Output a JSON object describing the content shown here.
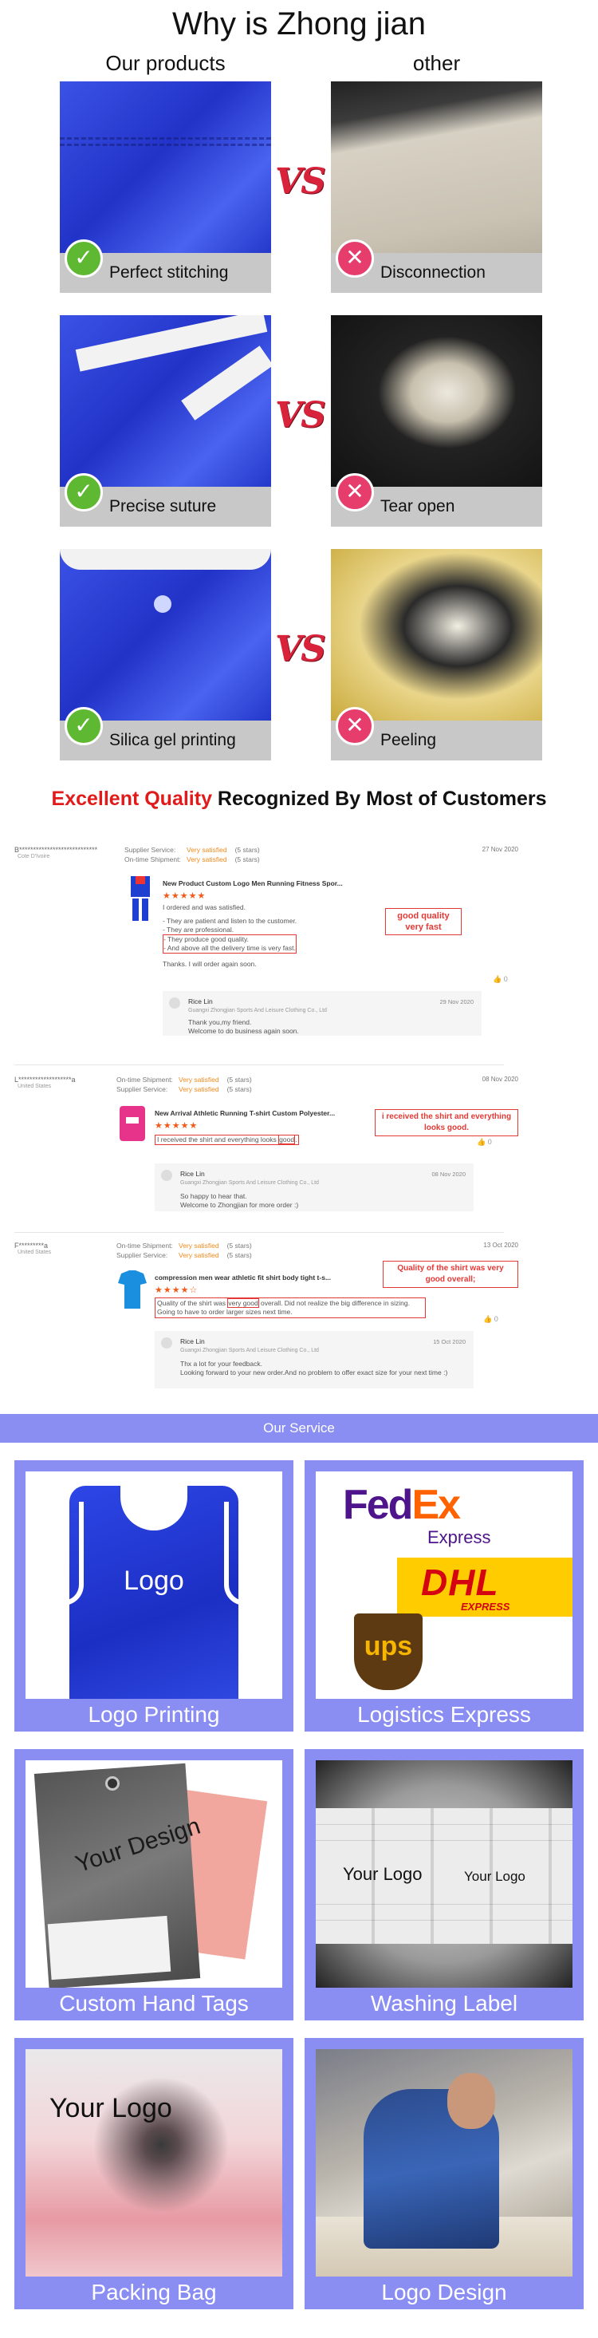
{
  "comparison": {
    "title": "Why is Zhong jian",
    "left_heading": "Our products",
    "right_heading": "other",
    "vs": "VS",
    "rows": [
      {
        "ours_label": "Perfect stitching",
        "theirs_label": "Disconnection"
      },
      {
        "ours_label": "Precise suture",
        "theirs_label": "Tear open"
      },
      {
        "ours_label": "Silica gel printing",
        "theirs_label": "Peeling"
      }
    ]
  },
  "quality_heading": {
    "red": "Excellent Quality",
    "rest": " Recognized By Most of Customers"
  },
  "reviews": [
    {
      "user": "B****************************",
      "country": "Cote D'Ivoire",
      "date": "27 Nov 2020",
      "meta": [
        {
          "key": "Supplier Service:",
          "value": "Very satisfied",
          "score": "(5 stars)"
        },
        {
          "key": "On-time Shipment:",
          "value": "Very satisfied",
          "score": "(5 stars)"
        }
      ],
      "product": "New Product Custom Logo Men Running Fitness Spor...",
      "stars": "★★★★★",
      "body": [
        "I ordered and was satisfied.",
        "",
        "- They are patient and listen to the customer.",
        "- They are professional.",
        "- They produce good quality.",
        "- And above all the delivery time is very fast.",
        "",
        "Thanks. I will order again soon."
      ],
      "callout": "good quality very fast",
      "likes": "0",
      "reply": {
        "name": "Rice Lin",
        "company": "Guangxi Zhongjian Sports And Leisure Clothing Co., Ltd",
        "date": "29 Nov 2020",
        "text": [
          "Thank  you,my friend.",
          "Welcome to do business again soon."
        ]
      }
    },
    {
      "user": "L*******************a",
      "country": "United States",
      "date": "08 Nov 2020",
      "meta": [
        {
          "key": "On-time Shipment:",
          "value": "Very satisfied",
          "score": "(5 stars)"
        },
        {
          "key": "Supplier Service:",
          "value": "Very satisfied",
          "score": "(5 stars)"
        }
      ],
      "product": "New Arrival Athletic Running T-shirt Custom Polyester...",
      "stars": "★★★★★",
      "body_pre": "I received the shirt and everything looks ",
      "body_hl": "good",
      "body_post": ".",
      "callout": "i received the shirt and everything looks good.",
      "likes": "0",
      "reply": {
        "name": "Rice Lin",
        "company": "Guangxi Zhongjian Sports And Leisure Clothing Co., Ltd",
        "date": "08 Nov 2020",
        "text": [
          "So happy to hear that.",
          "Welcome to Zhongjian for more order :)"
        ]
      }
    },
    {
      "user": "F*********a",
      "country": "United States",
      "date": "13 Oct 2020",
      "meta": [
        {
          "key": "On-time Shipment:",
          "value": "Very satisfied",
          "score": "(5 stars)"
        },
        {
          "key": "Supplier Service:",
          "value": "Very satisfied",
          "score": "(5 stars)"
        }
      ],
      "product": "compression men wear athletic fit shirt body tight t-s...",
      "stars": "★★★★☆",
      "body_pre": "Quality of the shirt was ",
      "body_hl": "very good",
      "body_post": " overall. Did not realize the big difference in sizing. Going to have to order larger sizes next time.",
      "callout": "Quality of the shirt was very good overall;",
      "likes": "0",
      "reply": {
        "name": "Rice Lin",
        "company": "Guangxi Zhongjian Sports And Leisure Clothing Co., Ltd",
        "date": "15 Oct 2020",
        "text": [
          "Thx a lot for your feedback.",
          "Looking forward to your new order.And no problem to offer exact size for your next time :)"
        ]
      }
    }
  ],
  "services": {
    "banner": "Our Service",
    "items": [
      {
        "caption": "Logo Printing",
        "overlay": "Logo"
      },
      {
        "caption": "Logistics Express",
        "fedex_fe": "Fed",
        "fedex_ex": "Ex",
        "fedex_sub": "Express",
        "dhl": "DHL",
        "dhl_sub": "EXPRESS",
        "ups": "ups"
      },
      {
        "caption": "Custom Hand Tags",
        "overlay": "Your Design"
      },
      {
        "caption": "Washing Label",
        "overlay_a": "Your Logo",
        "overlay_b": "Your Logo"
      },
      {
        "caption": "Packing Bag",
        "overlay": "Your Logo"
      },
      {
        "caption": "Logo Design"
      }
    ]
  },
  "colors": {
    "accent_red": "#e11a1a",
    "service_purple": "#8a8df2",
    "ok_green": "#5fb832",
    "bad_pink": "#e63d6d"
  }
}
